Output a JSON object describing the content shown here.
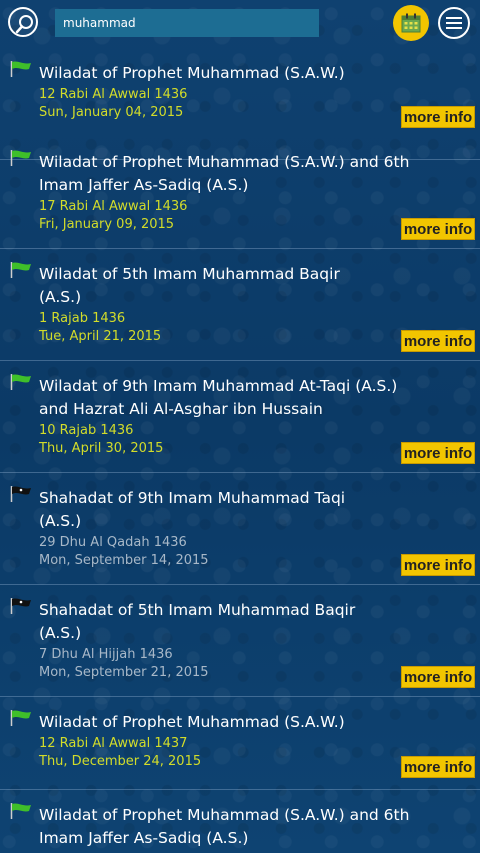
{
  "search": {
    "value": "muhammad"
  },
  "events": [
    {
      "kind": "wiladat",
      "title": "Wiladat of Prophet Muhammad (S.A.W.)",
      "hijri": "12 Rabi Al Awwal 1436",
      "gregorian": "Sun, January 04, 2015",
      "more": "more info"
    },
    {
      "kind": "wiladat",
      "title": "Wiladat of Prophet Muhammad (S.A.W.) and 6th Imam Jaffer As-Sadiq (A.S.)",
      "hijri": "17 Rabi Al Awwal 1436",
      "gregorian": "Fri, January 09, 2015",
      "more": "more info"
    },
    {
      "kind": "wiladat",
      "title": "Wiladat of 5th Imam Muhammad Baqir (A.S.)",
      "hijri": "1 Rajab 1436",
      "gregorian": "Tue, April 21, 2015",
      "more": "more info"
    },
    {
      "kind": "wiladat",
      "title": "Wiladat of 9th Imam Muhammad At-Taqi (A.S.) and Hazrat Ali Al-Asghar ibn Hussain",
      "hijri": "10 Rajab 1436",
      "gregorian": "Thu, April 30, 2015",
      "more": "more info"
    },
    {
      "kind": "shahadat",
      "title": "Shahadat of 9th Imam Muhammad Taqi (A.S.)",
      "hijri": "29 Dhu Al Qadah 1436",
      "gregorian": "Mon, September 14, 2015",
      "more": "more info"
    },
    {
      "kind": "shahadat",
      "title": "Shahadat of 5th Imam Muhammad Baqir (A.S.)",
      "hijri": "7 Dhu Al Hijjah 1436",
      "gregorian": "Mon, September 21, 2015",
      "more": "more info"
    },
    {
      "kind": "wiladat",
      "title": "Wiladat of Prophet Muhammad (S.A.W.)",
      "hijri": "12 Rabi Al Awwal 1437",
      "gregorian": "Thu, December 24, 2015",
      "more": "more info"
    },
    {
      "kind": "wiladat",
      "title": "Wiladat of Prophet Muhammad (S.A.W.) and 6th Imam Jaffer As-Sadiq (A.S.)"
    }
  ],
  "colors": {
    "accent": "#f2c500",
    "wiladat_text": "#d2dc2a",
    "shahadat_text": "#a8b8c8",
    "flag_green": "#3fbf2a",
    "flag_black": "#111111"
  }
}
